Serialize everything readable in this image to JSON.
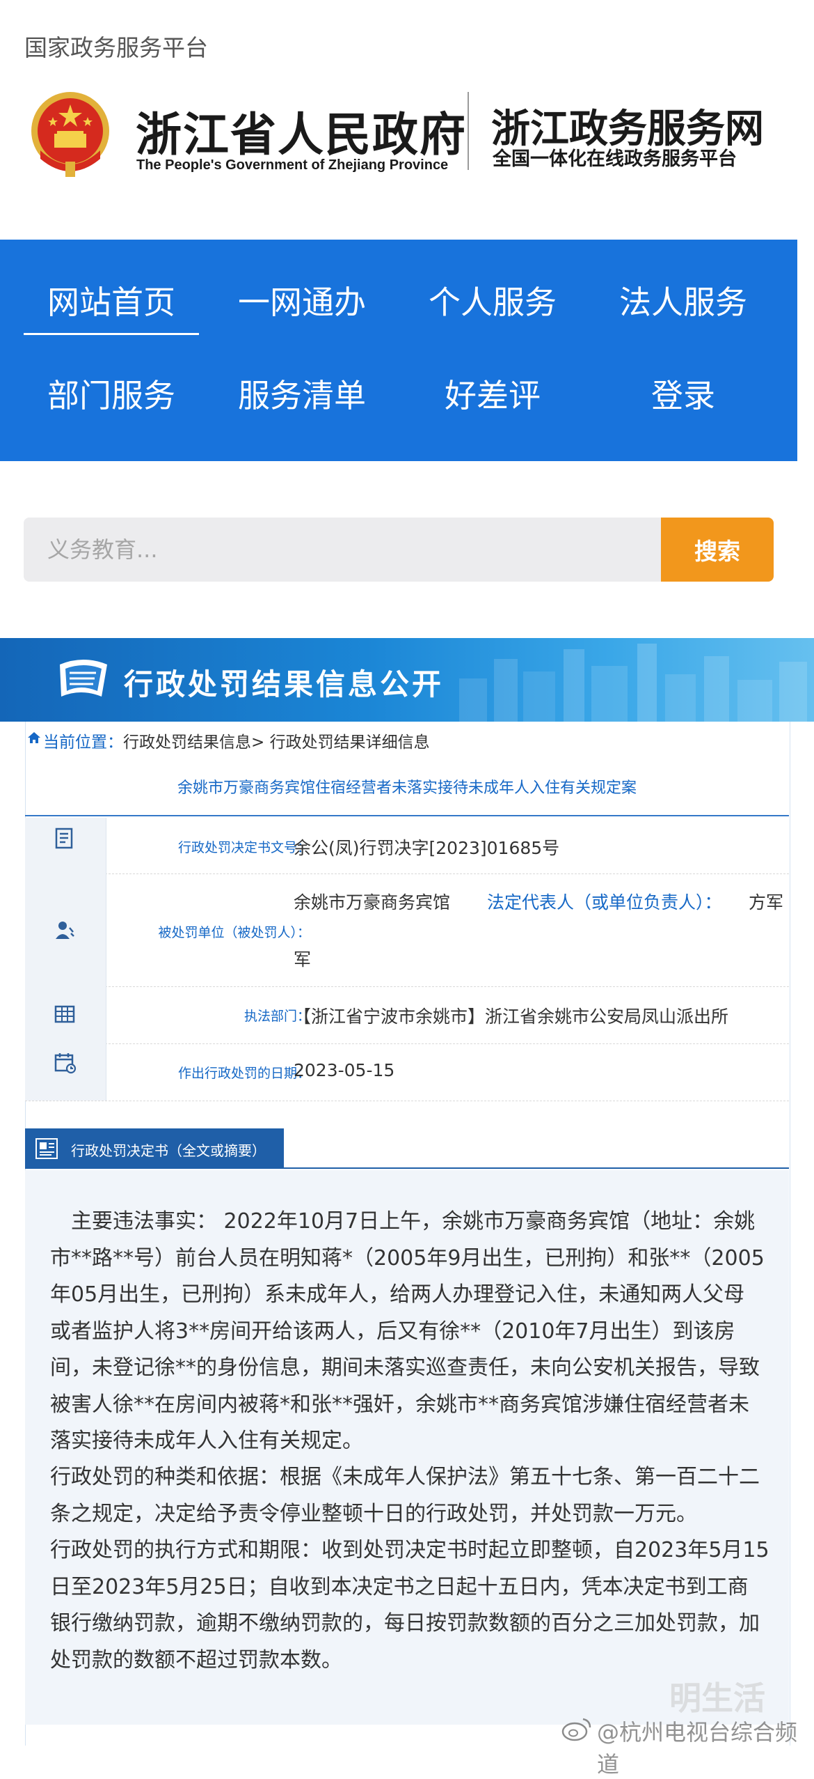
{
  "header": {
    "portal_label": "国家政务服务平台",
    "gov_name_cn": "浙江省人民政府",
    "gov_name_en": "The People's Government of Zhejiang Province",
    "service_title": "浙江政务服务网",
    "service_subtitle": "全国一体化在线政务服务平台"
  },
  "nav": {
    "items": [
      "网站首页",
      "一网通办",
      "个人服务",
      "法人服务",
      "部门服务",
      "服务清单",
      "好差评",
      "登录"
    ],
    "active": "网站首页",
    "color": "#1873dc"
  },
  "search": {
    "placeholder": "义务教育...",
    "button_label": "搜索",
    "button_color": "#f2971c"
  },
  "banner": {
    "title": "行政处罚结果信息公开"
  },
  "breadcrumb": {
    "label": "当前位置：",
    "path": "行政处罚结果信息> 行政处罚结果详细信息"
  },
  "case_title": "余姚市万豪商务宾馆住宿经营者未落实接待未成年人入住有关规定案",
  "info": {
    "doc_number": {
      "label": "行政处罚决定书文号：",
      "value": "余公(凤)行罚决字[2023]01685号",
      "icon": "document-icon"
    },
    "party": {
      "label": "被处罚单位（被处罚人）：",
      "name": "余姚市万豪商务宾馆",
      "rep_label": "法定代表人（或单位负责人）：",
      "rep_value_line1": "方军",
      "rep_value_line2": "军",
      "icon": "person-icon"
    },
    "department": {
      "label": "执法部门：",
      "value": "【浙江省宁波市余姚市】浙江省余姚市公安局凤山派出所",
      "icon": "building-icon"
    },
    "date": {
      "label": "作出行政处罚的日期：",
      "value": "2023-05-15",
      "icon": "calendar-icon"
    }
  },
  "decision": {
    "tab_label": "行政处罚决定书（全文或摘要）",
    "facts_lines": [
      "　主要违法事实：  2022年10月7日上午，余姚市万豪商务宾馆（地址：余姚",
      "市**路**号）前台人员在明知蒋*（2005年9月出生，已刑拘）和张**（2005",
      "年05月出生，已刑拘）系未成年人，给两人办理登记入住，未通知两人父母",
      "或者监护人将3**房间开给该两人，后又有徐**（2010年7月出生）到该房",
      "间，未登记徐**的身份信息，期间未落实巡查责任，未向公安机关报告，导致",
      "被害人徐**在房间内被蒋*和张**强奸，余姚市**商务宾馆涉嫌住宿经营者未",
      "落实接待未成年人入住有关规定。"
    ],
    "basis_lines": [
      "行政处罚的种类和依据：根据《未成年人保护法》第五十七条、第一百二十二",
      "条之规定，决定给予责令停业整顿十日的行政处罚，并处罚款一万元。"
    ],
    "execution_lines": [
      "行政处罚的执行方式和期限：收到处罚决定书时起立即整顿，自2023年5月15",
      "日至2023年5月25日；自收到本决定书之日起十五日内，凭本决定书到工商",
      "银行缴纳罚款，逾期不缴纳罚款的，每日按罚款数额的百分之三加处罚款，加",
      "处罚款的数额不超过罚款本数。"
    ]
  },
  "watermark": {
    "brand": "明生活",
    "source": "@杭州电视台综合频道"
  }
}
